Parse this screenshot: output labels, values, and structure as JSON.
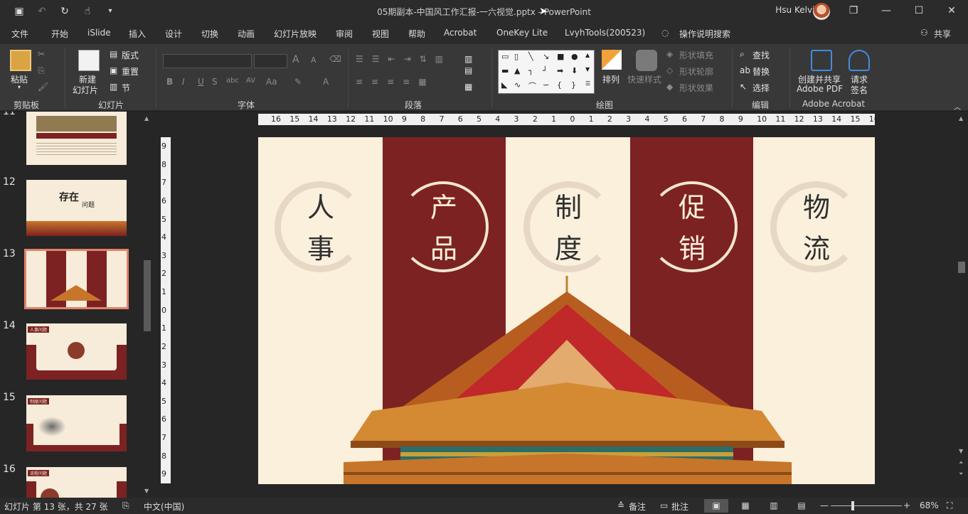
{
  "window": {
    "title": "05期副本-中国风工作汇报-一六视觉.pptx  -  PowerPoint",
    "user": "Hsu Kelvin",
    "controls": [
      "❐",
      "—",
      "☐",
      "✕"
    ]
  },
  "quick_access": [
    "save-icon",
    "undo-icon",
    "redo-icon",
    "touch-mode-icon",
    "customize-icon"
  ],
  "menu": {
    "items": [
      "文件",
      "开始",
      "iSlide",
      "插入",
      "设计",
      "切换",
      "动画",
      "幻灯片放映",
      "审阅",
      "视图",
      "帮助",
      "Acrobat",
      "OneKey Lite",
      "LvyhTools(200523)"
    ],
    "tell_me": "操作说明搜索",
    "share": "共享"
  },
  "ribbon": {
    "clipboard": {
      "label": "剪贴板",
      "paste": "粘贴"
    },
    "slides": {
      "label": "幻灯片",
      "new_slide_1": "新建",
      "new_slide_2": "幻灯片",
      "layout": "版式",
      "reset": "重置",
      "section": "节"
    },
    "font": {
      "label": "字体",
      "size_up": "A",
      "size_down": "A",
      "bold": "B",
      "italic": "I",
      "underline": "U",
      "strike": "S",
      "abc": "abc",
      "spacing": "AV",
      "case": "Aa",
      "color": "A"
    },
    "paragraph": {
      "label": "段落"
    },
    "drawing": {
      "label": "绘图",
      "arrange": "排列",
      "quick_styles": "快速样式",
      "fill": "形状填充",
      "outline": "形状轮廓",
      "effects": "形状效果"
    },
    "editing": {
      "label": "编辑",
      "find": "查找",
      "replace": "替换",
      "select": "选择"
    },
    "acrobat": {
      "label": "Adobe Acrobat",
      "create_1": "创建并共享",
      "create_2": "Adobe PDF",
      "request_1": "请求",
      "request_2": "签名"
    }
  },
  "thumbnails": [
    {
      "num": "11"
    },
    {
      "num": "12"
    },
    {
      "num": "13",
      "selected": true
    },
    {
      "num": "14"
    },
    {
      "num": "15"
    },
    {
      "num": "16"
    }
  ],
  "thumb_text": {
    "t12_title_a": "存在",
    "t12_title_b": "问题",
    "t14_tag": "人事问题",
    "t15_tag": "制度问题",
    "t16_tag": "流程问题"
  },
  "ruler": {
    "h": [
      "16",
      "15",
      "14",
      "13",
      "12",
      "11",
      "10",
      "9",
      "8",
      "7",
      "6",
      "5",
      "4",
      "3",
      "2",
      "1",
      "0",
      "1",
      "2",
      "3",
      "4",
      "5",
      "6",
      "7",
      "8",
      "9",
      "10",
      "11",
      "12",
      "13",
      "14",
      "15",
      "16"
    ],
    "v": [
      "9",
      "8",
      "7",
      "6",
      "5",
      "4",
      "3",
      "2",
      "1",
      "0",
      "1",
      "2",
      "3",
      "4",
      "5",
      "6",
      "7",
      "8",
      "9"
    ]
  },
  "slide": {
    "columns": [
      {
        "chars": [
          "人",
          "事"
        ],
        "style": "light"
      },
      {
        "chars": [
          "产",
          "品"
        ],
        "style": "red"
      },
      {
        "chars": [
          "制",
          "度"
        ],
        "style": "light"
      },
      {
        "chars": [
          "促",
          "销"
        ],
        "style": "red"
      },
      {
        "chars": [
          "物",
          "流"
        ],
        "style": "light"
      }
    ],
    "colors": {
      "red": "#7d2222",
      "cream": "#fbf0dc",
      "roof": "#c7752a",
      "gold": "#e0a43a"
    }
  },
  "status": {
    "slide_info": "幻灯片 第 13 张，共 27 张",
    "language": "中文(中国)",
    "notes": "备注",
    "comments": "批注",
    "zoom": "68%"
  }
}
